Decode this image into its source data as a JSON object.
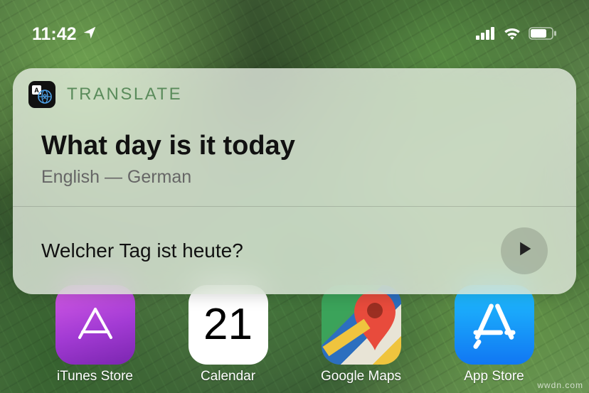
{
  "status": {
    "time": "11:42",
    "loc_icon": "location-arrow"
  },
  "card": {
    "app_title": "TRANSLATE",
    "source_text": "What day is it today",
    "language_pair": "English — German",
    "translated_text": "Welcher Tag ist heute?"
  },
  "home": {
    "calendar_day": "21",
    "labels": {
      "itunes": "iTunes Store",
      "calendar": "Calendar",
      "maps": "Google Maps",
      "appstore": "App Store"
    }
  },
  "watermark": "wwdn.com"
}
